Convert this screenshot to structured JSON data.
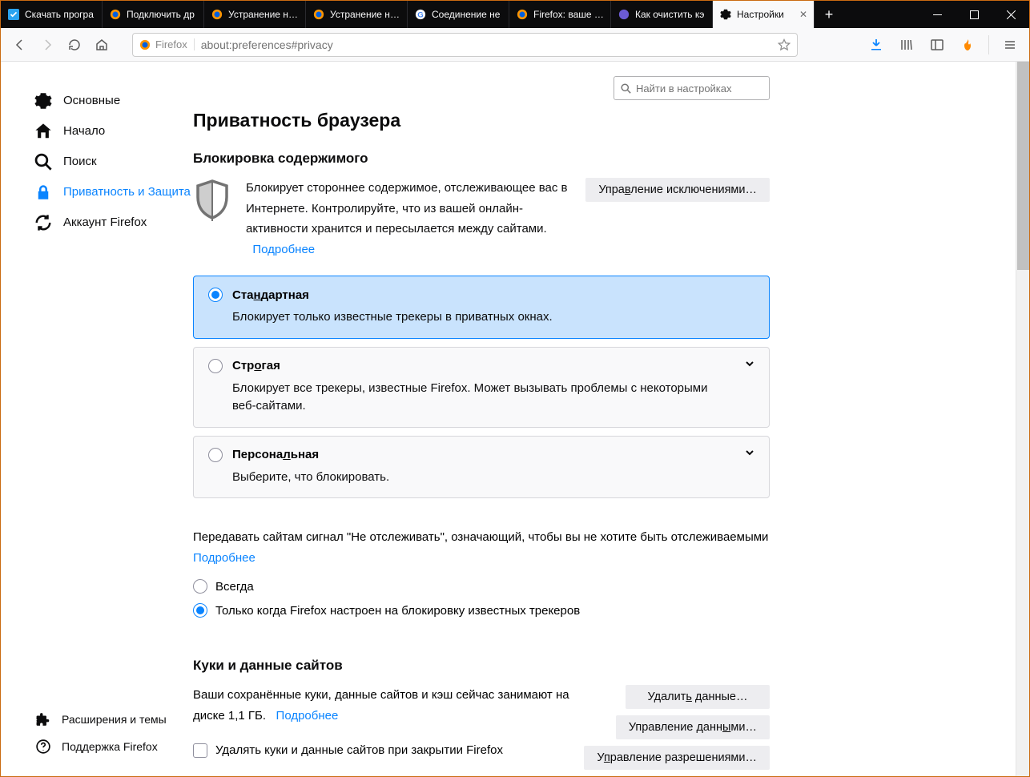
{
  "tabs": [
    {
      "label": "Скачать програ"
    },
    {
      "label": "Подключить др"
    },
    {
      "label": "Устранение неп"
    },
    {
      "label": "Устранение неп"
    },
    {
      "label": "Соединение не"
    },
    {
      "label": "Firefox: ваше со"
    },
    {
      "label": "Как очистить кэ"
    },
    {
      "label": "Настройки"
    }
  ],
  "url": {
    "identity": "Firefox",
    "path": "about:preferences#privacy"
  },
  "search": {
    "placeholder": "Найти в настройках"
  },
  "sidebar": {
    "items": [
      {
        "label": "Основные"
      },
      {
        "label": "Начало"
      },
      {
        "label": "Поиск"
      },
      {
        "label": "Приватность и Защита"
      },
      {
        "label": "Аккаунт Firefox"
      }
    ],
    "bottom": [
      {
        "label": "Расширения и темы"
      },
      {
        "label": "Поддержка Firefox"
      }
    ]
  },
  "headings": {
    "h1": "Приватность браузера",
    "h2_block": "Блокировка содержимого",
    "h2_cookies": "Куки и данные сайтов"
  },
  "blocking": {
    "desc": "Блокирует стороннее содержимое, отслеживающее вас в Интернете. Контролируйте, что из вашей онлайн-активности хранится и пересылается между сайтами.",
    "learn": "Подробнее",
    "exceptions_pre": "Упра",
    "exceptions_u": "в",
    "exceptions_post": "ление исключениями…"
  },
  "cards": {
    "standard": {
      "title_pre": "Ста",
      "title_u": "н",
      "title_post": "дартная",
      "desc": "Блокирует только известные трекеры в приватных окнах."
    },
    "strict": {
      "title_pre": "Стр",
      "title_u": "о",
      "title_post": "гая",
      "desc": "Блокирует все трекеры, известные Firefox. Может вызывать проблемы с некоторыми веб-сайтами."
    },
    "custom": {
      "title_pre": "Персона",
      "title_u": "л",
      "title_post": "ьная",
      "desc": "Выберите, что блокировать."
    }
  },
  "dnt": {
    "text": "Передавать сайтам сигнал \"Не отслеживать\", означающий, чтобы вы не хотите быть отслеживаемыми",
    "learn": "Подробнее",
    "always": "Всегда",
    "only": "Только когда Firefox настроен на блокировку известных трекеров"
  },
  "cookies": {
    "desc1": "Ваши сохранённые куки, данные сайтов и кэш сейчас занимают на диске 1,1 ГБ.",
    "learn": "Подробнее",
    "clear_pre": "Удалит",
    "clear_u": "ь",
    "clear_post": " данные…",
    "manage_pre": "Управление данн",
    "manage_u": "ы",
    "manage_post": "ми…",
    "perm_pre": "У",
    "perm_u": "п",
    "perm_post": "равление разрешениями…",
    "delonclose": "Удалять куки и данные сайтов при закрытии Firefox"
  }
}
